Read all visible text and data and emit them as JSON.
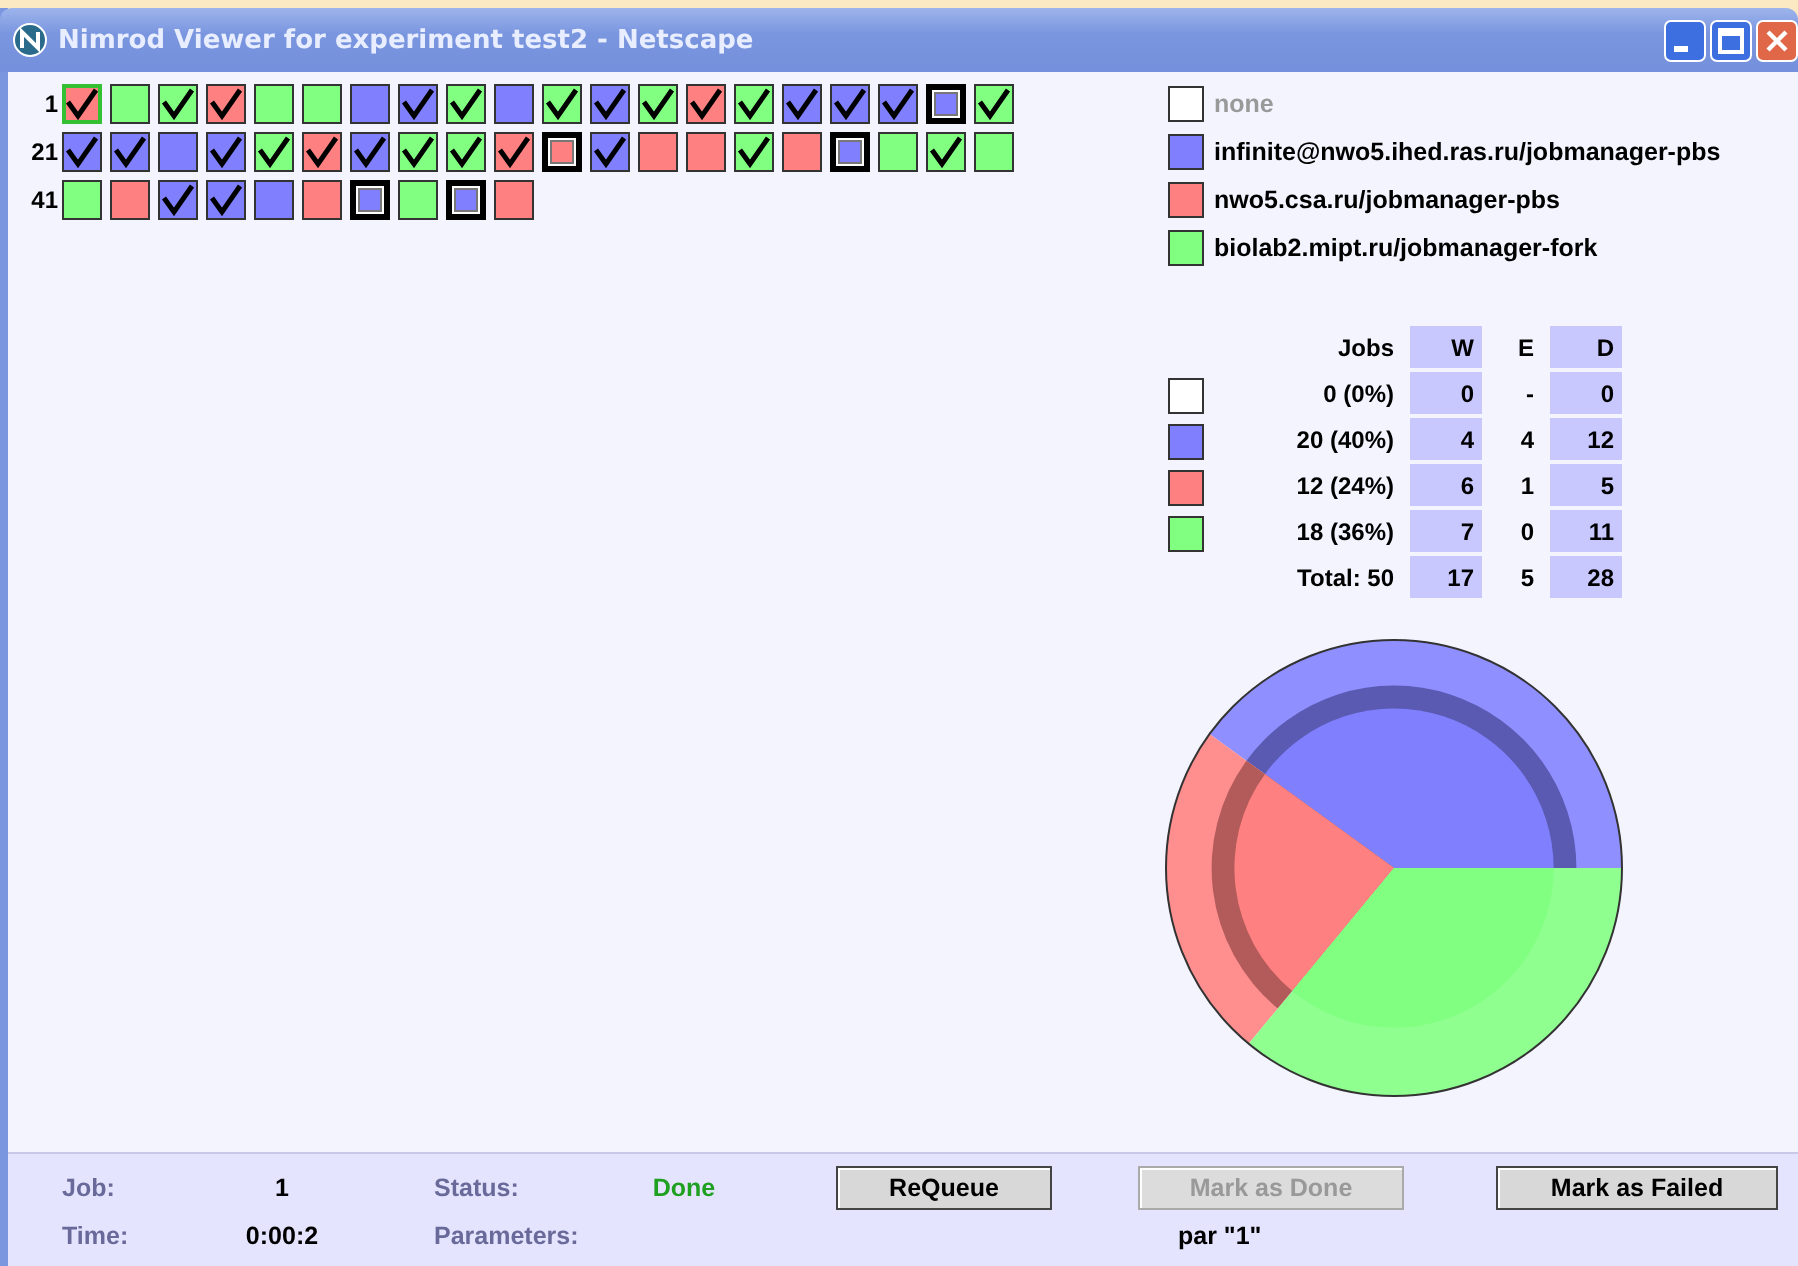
{
  "window": {
    "title": "Nimrod Viewer for experiment test2 - Netscape"
  },
  "job_grid": [
    {
      "label": "1",
      "cells": [
        {
          "color": "#ff8080",
          "kind": "done",
          "selected": true
        },
        {
          "color": "#80ff80",
          "kind": "waiting",
          "selected": false
        },
        {
          "color": "#80ff80",
          "kind": "done",
          "selected": false
        },
        {
          "color": "#ff8080",
          "kind": "done",
          "selected": false
        },
        {
          "color": "#80ff80",
          "kind": "waiting",
          "selected": false
        },
        {
          "color": "#80ff80",
          "kind": "waiting",
          "selected": false
        },
        {
          "color": "#8080ff",
          "kind": "waiting",
          "selected": false
        },
        {
          "color": "#8080ff",
          "kind": "done",
          "selected": false
        },
        {
          "color": "#80ff80",
          "kind": "done",
          "selected": false
        },
        {
          "color": "#8080ff",
          "kind": "waiting",
          "selected": false
        },
        {
          "color": "#80ff80",
          "kind": "done",
          "selected": false
        },
        {
          "color": "#8080ff",
          "kind": "done",
          "selected": false
        },
        {
          "color": "#80ff80",
          "kind": "done",
          "selected": false
        },
        {
          "color": "#ff8080",
          "kind": "done",
          "selected": false
        },
        {
          "color": "#80ff80",
          "kind": "done",
          "selected": false
        },
        {
          "color": "#8080ff",
          "kind": "done",
          "selected": false
        },
        {
          "color": "#8080ff",
          "kind": "done",
          "selected": false
        },
        {
          "color": "#8080ff",
          "kind": "done",
          "selected": false
        },
        {
          "color": "#8080ff",
          "kind": "running",
          "selected": false
        },
        {
          "color": "#80ff80",
          "kind": "done",
          "selected": false
        }
      ]
    },
    {
      "label": "21",
      "cells": [
        {
          "color": "#8080ff",
          "kind": "done",
          "selected": false
        },
        {
          "color": "#8080ff",
          "kind": "done",
          "selected": false
        },
        {
          "color": "#8080ff",
          "kind": "waiting",
          "selected": false
        },
        {
          "color": "#8080ff",
          "kind": "done",
          "selected": false
        },
        {
          "color": "#80ff80",
          "kind": "done",
          "selected": false
        },
        {
          "color": "#ff8080",
          "kind": "done",
          "selected": false
        },
        {
          "color": "#8080ff",
          "kind": "done",
          "selected": false
        },
        {
          "color": "#80ff80",
          "kind": "done",
          "selected": false
        },
        {
          "color": "#80ff80",
          "kind": "done",
          "selected": false
        },
        {
          "color": "#ff8080",
          "kind": "done",
          "selected": false
        },
        {
          "color": "#ff8080",
          "kind": "running",
          "selected": false
        },
        {
          "color": "#8080ff",
          "kind": "done",
          "selected": false
        },
        {
          "color": "#ff8080",
          "kind": "waiting",
          "selected": false
        },
        {
          "color": "#ff8080",
          "kind": "waiting",
          "selected": false
        },
        {
          "color": "#80ff80",
          "kind": "done",
          "selected": false
        },
        {
          "color": "#ff8080",
          "kind": "waiting",
          "selected": false
        },
        {
          "color": "#8080ff",
          "kind": "running",
          "selected": false
        },
        {
          "color": "#80ff80",
          "kind": "waiting",
          "selected": false
        },
        {
          "color": "#80ff80",
          "kind": "done",
          "selected": false
        },
        {
          "color": "#80ff80",
          "kind": "waiting",
          "selected": false
        }
      ]
    },
    {
      "label": "41",
      "cells": [
        {
          "color": "#80ff80",
          "kind": "waiting",
          "selected": false
        },
        {
          "color": "#ff8080",
          "kind": "waiting",
          "selected": false
        },
        {
          "color": "#8080ff",
          "kind": "done",
          "selected": false
        },
        {
          "color": "#8080ff",
          "kind": "done",
          "selected": false
        },
        {
          "color": "#8080ff",
          "kind": "waiting",
          "selected": false
        },
        {
          "color": "#ff8080",
          "kind": "waiting",
          "selected": false
        },
        {
          "color": "#8080ff",
          "kind": "running",
          "selected": false
        },
        {
          "color": "#80ff80",
          "kind": "waiting",
          "selected": false
        },
        {
          "color": "#8080ff",
          "kind": "running",
          "selected": false
        },
        {
          "color": "#ff8080",
          "kind": "waiting",
          "selected": false
        }
      ]
    }
  ],
  "legend": [
    {
      "label": "none",
      "color": "#ffffff",
      "disabled": true
    },
    {
      "label": "infinite@nwo5.ihed.ras.ru/jobmanager-pbs",
      "color": "#8080ff",
      "disabled": false
    },
    {
      "label": "nwo5.csa.ru/jobmanager-pbs",
      "color": "#ff8080",
      "disabled": false
    },
    {
      "label": "biolab2.mipt.ru/jobmanager-fork",
      "color": "#80ff80",
      "disabled": false
    }
  ],
  "stats_table": {
    "columns": [
      "Jobs",
      "W",
      "E",
      "D"
    ],
    "rows": [
      {
        "color": "#ffffff",
        "cells": [
          "0 (0%)",
          "0",
          "-",
          "0"
        ]
      },
      {
        "color": "#8080ff",
        "cells": [
          "20 (40%)",
          "4",
          "4",
          "12"
        ]
      },
      {
        "color": "#ff8080",
        "cells": [
          "12 (24%)",
          "6",
          "1",
          "5"
        ]
      },
      {
        "color": "#80ff80",
        "cells": [
          "18 (36%)",
          "7",
          "0",
          "11"
        ]
      }
    ],
    "total": [
      "Total: 50",
      "17",
      "5",
      "28"
    ]
  },
  "details": {
    "fields": [
      {
        "label": "Job:",
        "value": "1",
        "kind": "plain"
      },
      {
        "label": "Status:",
        "value": "Done",
        "kind": "status"
      },
      {
        "label": "Time:",
        "value": "0:00:2",
        "kind": "plain"
      },
      {
        "label": "Parameters:",
        "value": "par \"1\"",
        "kind": "wide"
      }
    ],
    "buttons": [
      {
        "label": "ReQueue",
        "disabled": false
      },
      {
        "label": "Mark as Done",
        "disabled": true
      },
      {
        "label": "Mark as Failed",
        "disabled": false
      }
    ]
  }
}
